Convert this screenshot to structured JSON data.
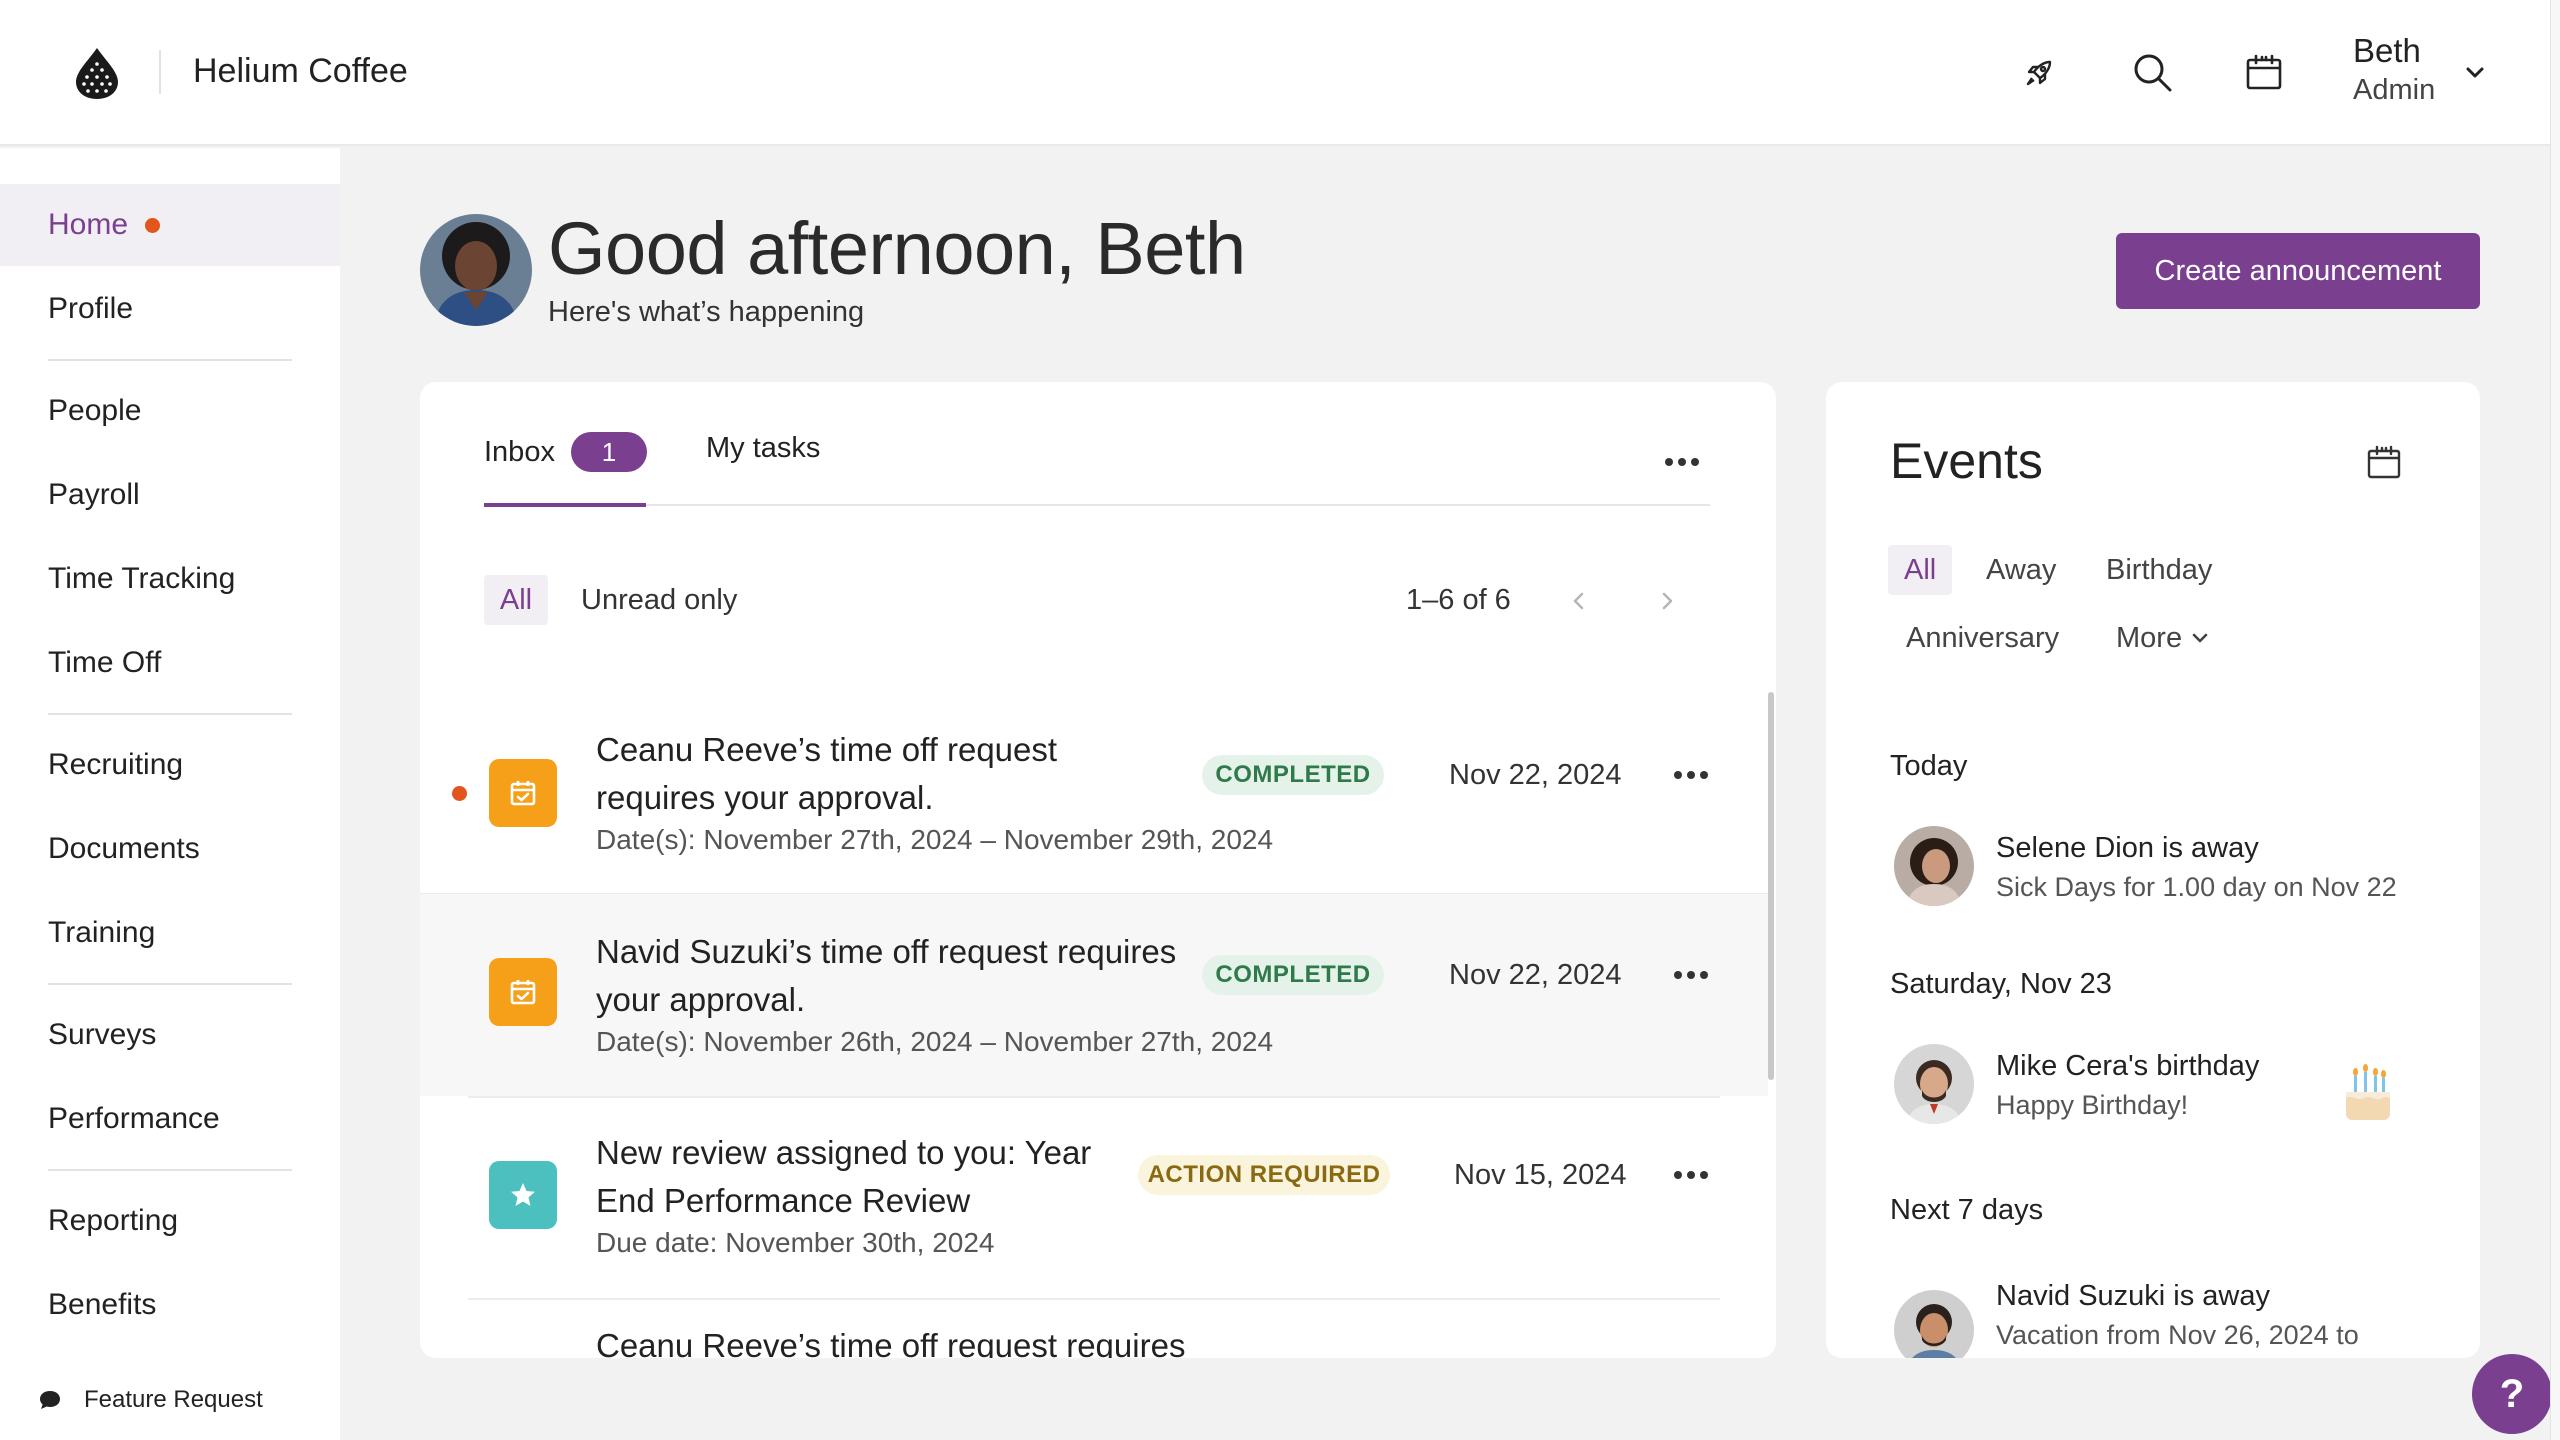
{
  "app": {
    "brand": "Helium Coffee"
  },
  "header": {
    "user_name": "Beth",
    "user_role": "Admin",
    "icons": [
      "rocket-icon",
      "search-icon",
      "calendar-icon",
      "chevron-down-icon"
    ]
  },
  "sidebar": {
    "items": [
      {
        "label": "Home",
        "active": true,
        "has_dot": true
      },
      {
        "label": "Profile"
      },
      {
        "label": "People"
      },
      {
        "label": "Payroll"
      },
      {
        "label": "Time Tracking"
      },
      {
        "label": "Time Off"
      },
      {
        "label": "Recruiting"
      },
      {
        "label": "Documents"
      },
      {
        "label": "Training"
      },
      {
        "label": "Surveys"
      },
      {
        "label": "Performance"
      },
      {
        "label": "Reporting"
      },
      {
        "label": "Benefits"
      }
    ],
    "feature_request": "Feature Request"
  },
  "greeting": {
    "title": "Good afternoon, Beth",
    "subtitle": "Here's what’s happening",
    "create_button": "Create announcement"
  },
  "inbox": {
    "tabs": [
      {
        "label": "Inbox",
        "badge": "1",
        "active": true
      },
      {
        "label": "My tasks"
      }
    ],
    "filters": {
      "all": "All",
      "unread": "Unread only"
    },
    "pagination": "1–6 of 6",
    "rows": [
      {
        "title": "Ceanu Reeve’s time off request requires your approval.",
        "subtitle": "Date(s): November 27th, 2024 – November 29th, 2024",
        "status": "COMPLETED",
        "date": "Nov 22, 2024",
        "unread": true,
        "icon": "calendar-check-icon"
      },
      {
        "title": "Navid Suzuki’s time off request requires your approval.",
        "subtitle": "Date(s): November 26th, 2024 – November 27th, 2024",
        "status": "COMPLETED",
        "date": "Nov 22, 2024",
        "unread": false,
        "icon": "calendar-check-icon"
      },
      {
        "title": "New review assigned to you: Year End Performance Review",
        "subtitle": "Due date: November 30th, 2024",
        "status": "ACTION REQUIRED",
        "date": "Nov 15, 2024",
        "unread": false,
        "icon": "star-icon"
      },
      {
        "title": "Ceanu Reeve’s time off request requires",
        "subtitle": "",
        "status": "",
        "date": "",
        "unread": false,
        "icon": "calendar-check-icon"
      }
    ]
  },
  "events": {
    "title": "Events",
    "filters": [
      "All",
      "Away",
      "Birthday",
      "Anniversary",
      "More"
    ],
    "sections": [
      {
        "label": "Today",
        "items": [
          {
            "name": "Selene Dion is away",
            "detail": "Sick Days for 1.00 day on Nov 22"
          }
        ]
      },
      {
        "label": "Saturday, Nov 23",
        "items": [
          {
            "name": "Mike Cera's birthday",
            "detail": "Happy Birthday!"
          }
        ]
      },
      {
        "label": "Next 7 days",
        "items": [
          {
            "name": "Navid Suzuki is away",
            "detail": "Vacation from Nov 26, 2024 to"
          }
        ]
      }
    ]
  },
  "colors": {
    "accent": "#7a3f8f",
    "unread_dot": "#e0561d",
    "completed_bg": "#e5f2ea",
    "completed_text": "#2f7a4a",
    "action_bg": "#fbf4dd",
    "action_text": "#8a6a10"
  },
  "help": {
    "label": "?"
  }
}
